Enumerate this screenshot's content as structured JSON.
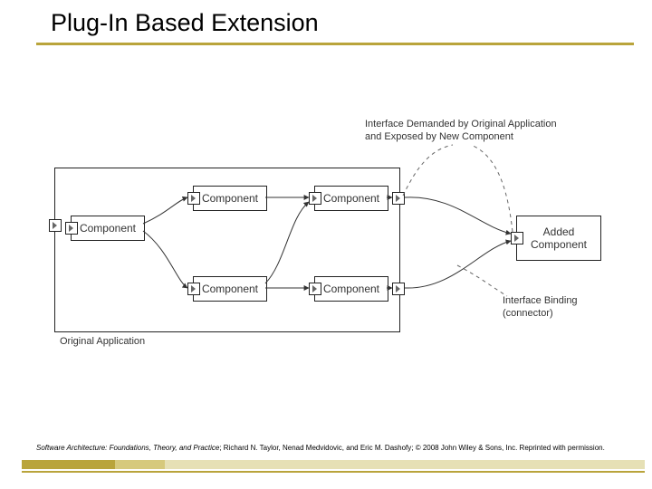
{
  "title": "Plug-In Based Extension",
  "labels": {
    "interface_demanded": "Interface Demanded by Original Application\nand Exposed by New Component",
    "interface_binding": "Interface Binding\n(connector)",
    "original_app": "Original Application"
  },
  "components": {
    "orig1": "Component",
    "orig2": "Component",
    "orig3": "Component",
    "orig4": "Component",
    "orig5": "Component",
    "added": "Added\nComponent"
  },
  "citation": {
    "italic": "Software Architecture: Foundations, Theory, and Practice",
    "rest": "; Richard N. Taylor, Nenad Medvidovic, and Eric M. Dashofy; © 2008 John Wiley & Sons, Inc. Reprinted with permission."
  }
}
